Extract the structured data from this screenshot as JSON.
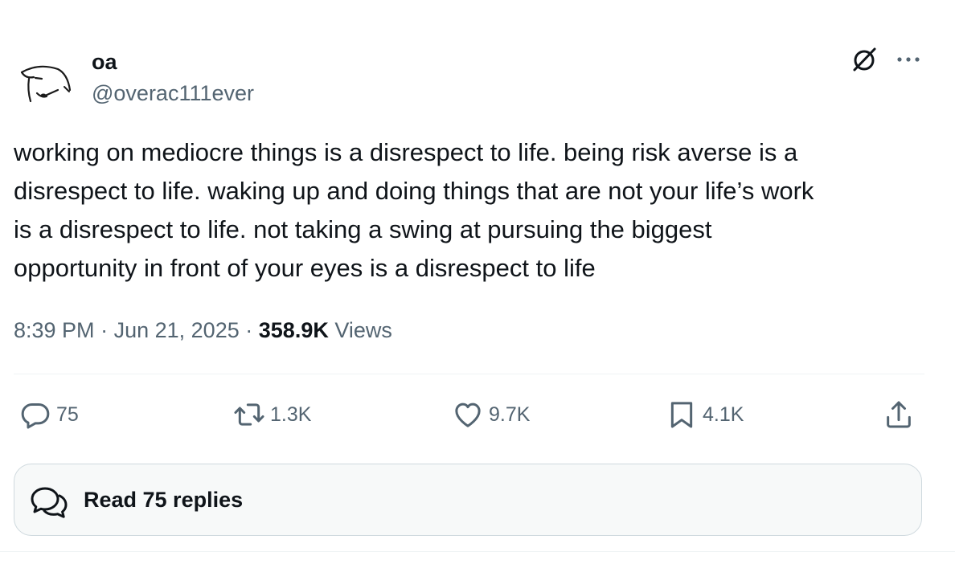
{
  "author": {
    "name": "oa",
    "handle": "@overac111ever"
  },
  "tweet": {
    "text": "working on mediocre things is a disrespect to life. being risk averse is a\ndisrespect to life. waking up and doing things that are not your life’s work\nis a disrespect to life. not taking a swing at pursuing the biggest\nopportunity in front of your eyes is a disrespect to life",
    "time": "8:39 PM",
    "date": "Jun 21, 2025",
    "separator": "·",
    "views_count": "358.9K",
    "views_label": "Views"
  },
  "actions": {
    "replies": "75",
    "retweets": "1.3K",
    "likes": "9.7K",
    "bookmarks": "4.1K"
  },
  "read_replies": {
    "label": "Read 75 replies"
  },
  "icons": {
    "header": [
      "grok-icon",
      "more-icon"
    ],
    "actions": [
      "reply-icon",
      "retweet-icon",
      "like-icon",
      "bookmark-icon",
      "share-icon"
    ],
    "read_replies": "speech-bubbles-icon"
  },
  "colors": {
    "text": "#0f1419",
    "secondary": "#536471",
    "border": "#cfd9de",
    "divider": "#eff3f4",
    "button_bg": "#f7f9f9"
  }
}
